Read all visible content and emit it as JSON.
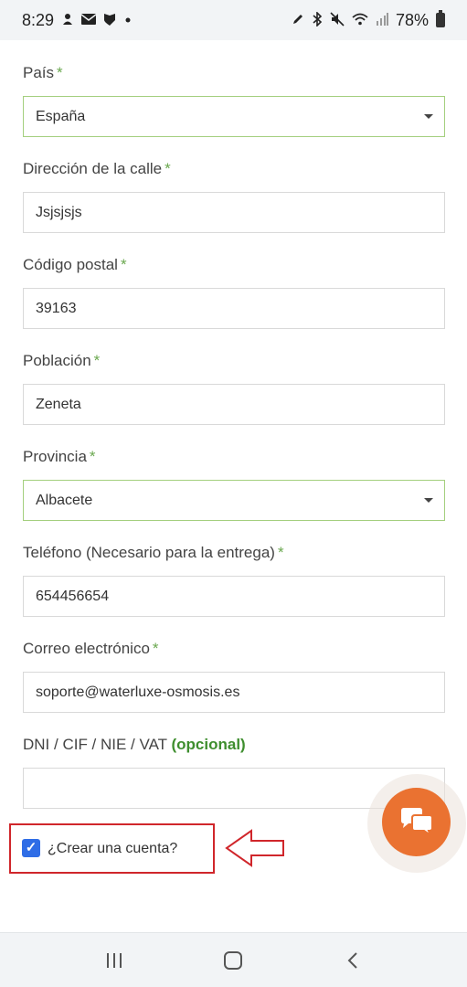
{
  "status_bar": {
    "time": "8:29",
    "battery": "78%",
    "left_icons": [
      "notification-icon",
      "mail-icon",
      "shield-icon",
      "dot-icon"
    ],
    "right_icons": [
      "pen-icon",
      "bluetooth-icon",
      "mute-icon",
      "wifi-icon",
      "signal-icon",
      "battery-icon"
    ]
  },
  "form": {
    "country": {
      "label": "País",
      "required": "*",
      "value": "España"
    },
    "street": {
      "label": "Dirección de la calle",
      "required": "*",
      "value": "Jsjsjsjs"
    },
    "postal_code": {
      "label": "Código postal",
      "required": "*",
      "value": "39163"
    },
    "city": {
      "label": "Población",
      "required": "*",
      "value": "Zeneta"
    },
    "province": {
      "label": "Provincia",
      "required": "*",
      "value": "Albacete"
    },
    "phone": {
      "label": "Teléfono (Necesario para la entrega)",
      "required": "*",
      "value": "654456654"
    },
    "email": {
      "label": "Correo electrónico",
      "required": "*",
      "value": "soporte@waterluxe-osmosis.es"
    },
    "tax_id": {
      "label": "DNI / CIF / NIE / VAT",
      "optional": "(opcional)",
      "value": ""
    }
  },
  "create_account": {
    "label": "¿Crear una cuenta?",
    "checked": true
  },
  "colors": {
    "accent_green": "#a4cf7e",
    "required_green": "#6aa84f",
    "checkbox_blue": "#2f6de6",
    "chat_orange": "#ea7231",
    "annotation_red": "#d0262b"
  },
  "chat": {
    "icon": "chat-bubbles-icon"
  },
  "nav": {
    "items": [
      "recent-apps-icon",
      "home-icon",
      "back-icon"
    ]
  }
}
